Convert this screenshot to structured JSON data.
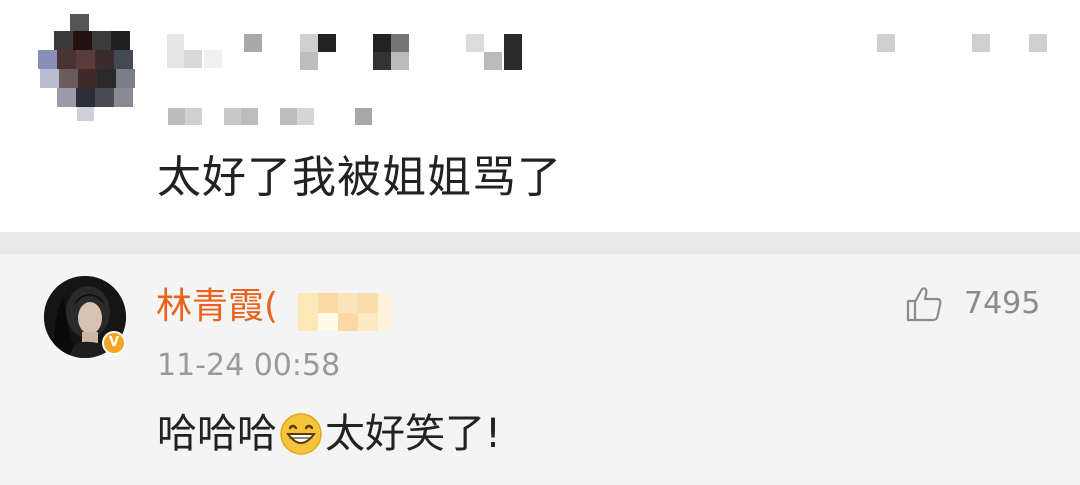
{
  "original_comment": {
    "text": "太好了我被姐姐骂了"
  },
  "reply": {
    "author": {
      "name": "林青霞(",
      "verified_badge": "V",
      "verified_color": "#f5a623"
    },
    "timestamp": "11-24 00:58",
    "likes": "7495",
    "text_before_emoji": "哈哈哈",
    "emoji": "grinning-face-icon",
    "text_after_emoji": "太好笑了!"
  },
  "colors": {
    "username": "#e8631d",
    "meta_gray": "#999999",
    "divider": "#e9e9e9",
    "reply_bg": "#f4f4f4"
  }
}
